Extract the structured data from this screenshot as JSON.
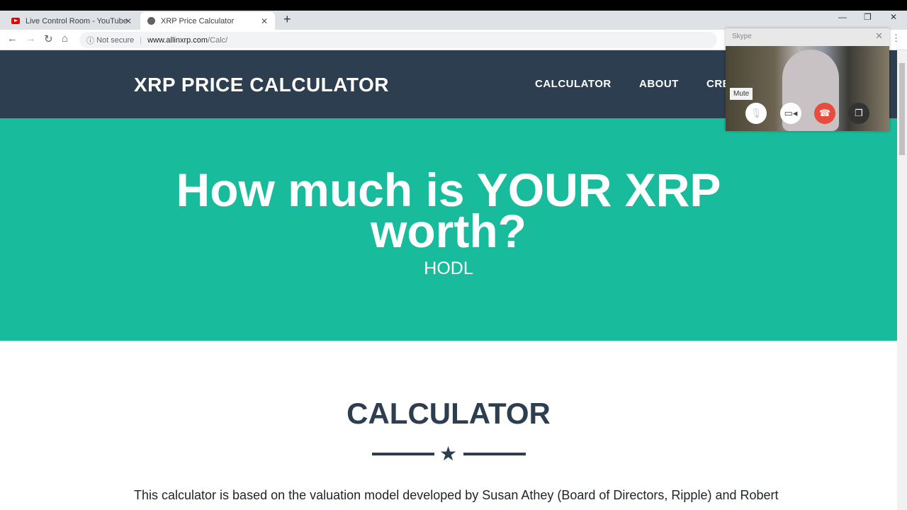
{
  "browser": {
    "tabs": [
      {
        "title": "Live Control Room - YouTube",
        "icon": "youtube-icon",
        "active": false
      },
      {
        "title": "XRP Price Calculator",
        "icon": "globe-icon",
        "active": true
      }
    ],
    "security_label": "Not secure",
    "url_host": "www.allinxrp.com",
    "url_path": "/Calc/"
  },
  "site": {
    "brand": "XRP PRICE CALCULATOR",
    "nav": [
      "CALCULATOR",
      "ABOUT",
      "CRE"
    ],
    "hero_title_line1": "How much is YOUR XRP",
    "hero_title_line2": "worth?",
    "hero_subtitle": "HODL",
    "section_title": "CALCULATOR",
    "intro": "This calculator is based on the valuation model developed by Susan Athey (Board of Directors, Ripple) and Robert"
  },
  "skype": {
    "title": "Skype",
    "tooltip": "Mute",
    "colors": {
      "hangup": "#e74c3c"
    }
  },
  "colors": {
    "header": "#2c3e50",
    "hero": "#18bc9c"
  }
}
